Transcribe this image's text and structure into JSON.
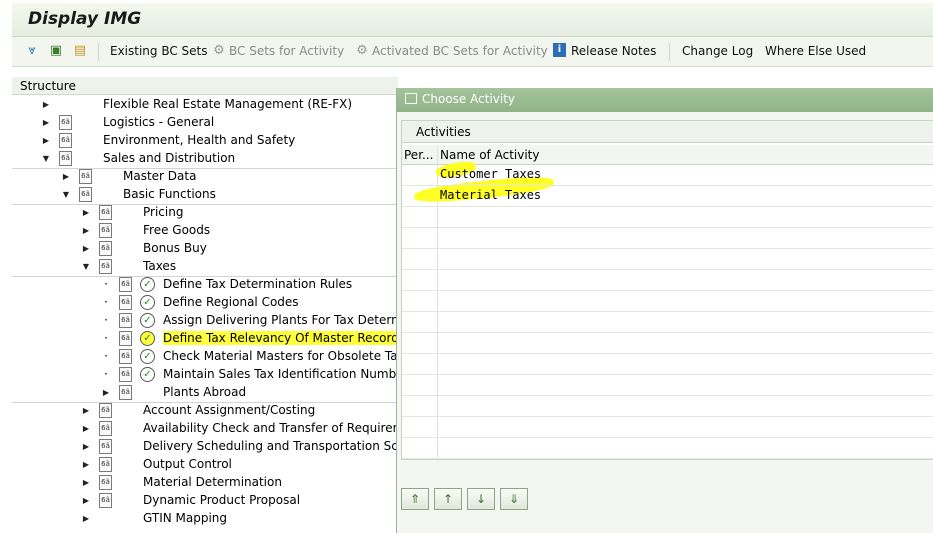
{
  "window": {
    "title": "Display IMG"
  },
  "toolbar": {
    "existing_bc_sets": "Existing BC Sets",
    "bc_sets_for_activity": "BC Sets for Activity",
    "activated_bc_sets": "Activated BC Sets for Activity",
    "release_notes": "Release Notes",
    "change_log": "Change Log",
    "where_else_used": "Where Else Used"
  },
  "structure": {
    "header": "Structure",
    "items": [
      {
        "label": "Flexible Real Estate Management (RE-FX)"
      },
      {
        "label": "Logistics - General"
      },
      {
        "label": "Environment, Health and Safety"
      },
      {
        "label": "Sales and Distribution"
      },
      {
        "label": "Master Data"
      },
      {
        "label": "Basic Functions"
      },
      {
        "label": "Pricing"
      },
      {
        "label": "Free Goods"
      },
      {
        "label": "Bonus Buy"
      },
      {
        "label": "Taxes"
      },
      {
        "label": "Define Tax Determination Rules"
      },
      {
        "label": "Define Regional Codes"
      },
      {
        "label": "Assign Delivering Plants For Tax Determinat"
      },
      {
        "label": "Define Tax Relevancy Of Master Records"
      },
      {
        "label": "Check Material Masters for Obsolete Tax Cl"
      },
      {
        "label": "Maintain Sales Tax Identification Number D"
      },
      {
        "label": "Plants Abroad"
      },
      {
        "label": "Account Assignment/Costing"
      },
      {
        "label": "Availability Check and Transfer of Requirement"
      },
      {
        "label": "Delivery Scheduling and Transportation Schedu"
      },
      {
        "label": "Output Control"
      },
      {
        "label": "Material Determination"
      },
      {
        "label": "Dynamic Product Proposal"
      },
      {
        "label": "GTIN Mapping"
      }
    ]
  },
  "dialog": {
    "title": "Choose Activity",
    "panel_title": "Activities",
    "col_per": "Per...",
    "col_name": "Name of Activity",
    "rows": [
      {
        "name": "Customer Taxes"
      },
      {
        "name": "Material Taxes"
      }
    ]
  },
  "colors": {
    "highlight": "#ffff3a",
    "dialog_title": "#9bbd92"
  }
}
